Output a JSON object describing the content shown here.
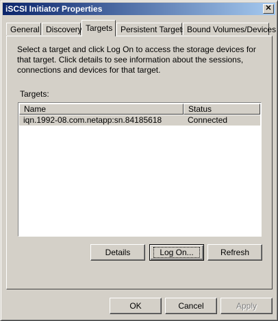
{
  "window": {
    "title": "iSCSI Initiator Properties",
    "close_symbol": "✕"
  },
  "tabs": [
    {
      "label": "General"
    },
    {
      "label": "Discovery"
    },
    {
      "label": "Targets"
    },
    {
      "label": "Persistent Targets"
    },
    {
      "label": "Bound Volumes/Devices"
    }
  ],
  "active_tab": "Targets",
  "description": "Select a target and click Log On to access the storage devices for that target. Click details to see information about the sessions, connections and devices for that target.",
  "targets_label": "Targets:",
  "table": {
    "columns": [
      "Name",
      "Status"
    ],
    "rows": [
      {
        "name": "iqn.1992-08.com.netapp:sn.84185618",
        "status": "Connected"
      }
    ]
  },
  "panel_buttons": {
    "details": "Details",
    "logon": "Log On...",
    "refresh": "Refresh"
  },
  "dialog_buttons": {
    "ok": "OK",
    "cancel": "Cancel",
    "apply": "Apply"
  },
  "colors": {
    "titlebar_start": "#0a246a",
    "titlebar_end": "#a6caf0",
    "face": "#d4d0c8"
  }
}
